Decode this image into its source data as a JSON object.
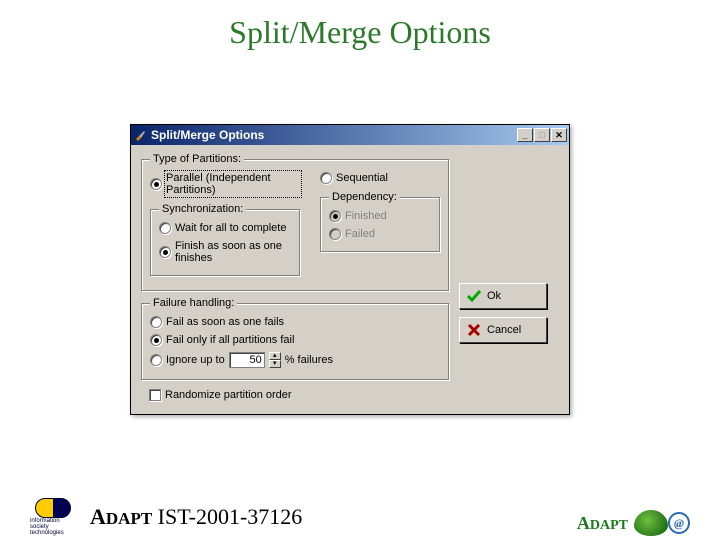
{
  "slide": {
    "title": "Split/Merge Options"
  },
  "window": {
    "title": "Split/Merge Options",
    "icon_name": "paintbrush-icon"
  },
  "groups": {
    "partitions_legend": "Type of Partitions:",
    "sync_legend": "Synchronization:",
    "dependency_legend": "Dependency:",
    "failure_legend": "Failure handling:"
  },
  "options": {
    "parallel": "Parallel (Independent Partitions)",
    "sequential": "Sequential",
    "wait_all": "Wait for all to complete",
    "finish_one": "Finish as soon as one finishes",
    "dep_finished": "Finished",
    "dep_failed": "Failed",
    "fail_one": "Fail as soon as one fails",
    "fail_all": "Fail only if all partitions fail",
    "ignore_prefix": "Ignore up to",
    "ignore_value": "50",
    "ignore_suffix": "% failures",
    "randomize": "Randomize partition order"
  },
  "buttons": {
    "ok": "Ok",
    "cancel": "Cancel"
  },
  "footer": {
    "project_prefix": "A",
    "project_caps": "DAPT",
    "project_code": "IST-2001-37126",
    "brand_prefix": "A",
    "brand_caps": "DAPT",
    "ist_label": "information society technologies"
  }
}
